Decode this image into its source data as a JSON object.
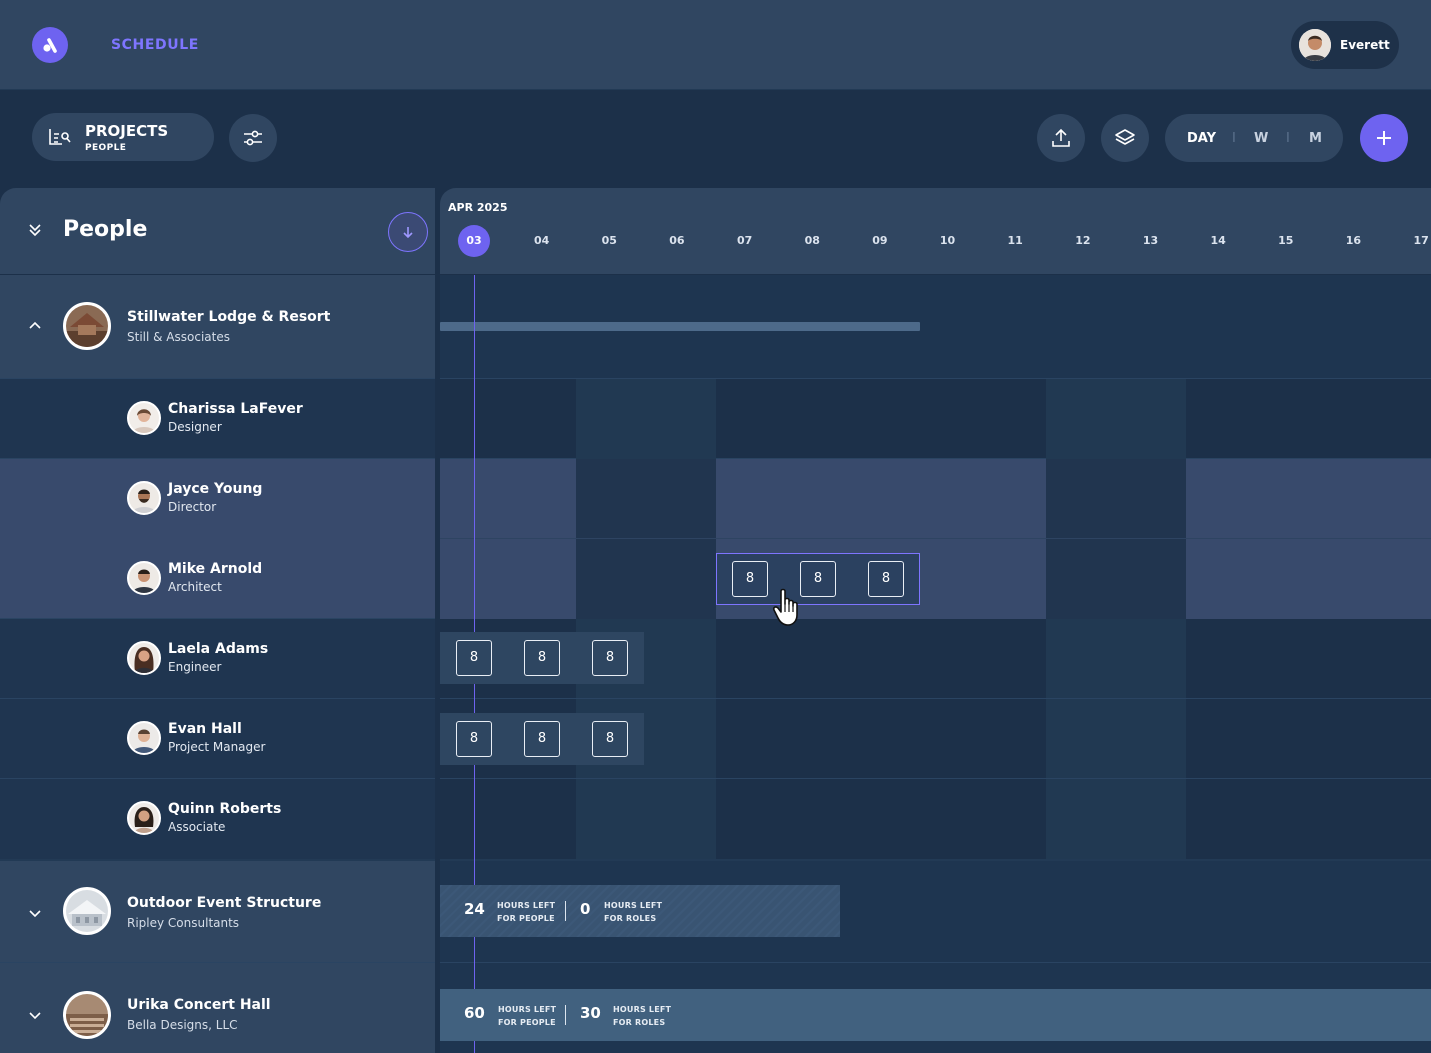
{
  "app": {
    "title": "SCHEDULE",
    "user": "Everett"
  },
  "toolbar": {
    "projects_label": "PROJECTS",
    "people_label": "PEOPLE",
    "view_day": "DAY",
    "view_week": "W",
    "view_month": "M",
    "separator": "I"
  },
  "sidebar": {
    "title": "People"
  },
  "timeline": {
    "month": "APR 2025",
    "days": [
      "03",
      "04",
      "05",
      "06",
      "07",
      "08",
      "09",
      "10",
      "11",
      "12",
      "13",
      "14",
      "15",
      "16",
      "17"
    ],
    "today": "03"
  },
  "projects": [
    {
      "name": "Stillwater Lodge & Resort",
      "client": "Still & Associates",
      "expanded": true,
      "people": [
        {
          "name": "Charissa LaFever",
          "role": "Designer",
          "hours": []
        },
        {
          "name": "Jayce Young",
          "role": "Director",
          "hours": []
        },
        {
          "name": "Mike Arnold",
          "role": "Architect",
          "hours": [
            "8",
            "8",
            "8"
          ]
        },
        {
          "name": "Laela Adams",
          "role": "Engineer",
          "hours": [
            "8",
            "8",
            "8"
          ]
        },
        {
          "name": "Evan Hall",
          "role": "Project Manager",
          "hours": [
            "8",
            "8",
            "8"
          ]
        },
        {
          "name": "Quinn Roberts",
          "role": "Associate",
          "hours": []
        }
      ]
    },
    {
      "name": "Outdoor Event Structure",
      "client": "Ripley Consultants",
      "expanded": false,
      "summary": {
        "people_hours": "24",
        "people_label_1": "HOURS LEFT",
        "people_label_2": "FOR PEOPLE",
        "roles_hours": "0",
        "roles_label_1": "HOURS LEFT",
        "roles_label_2": "FOR ROLES"
      }
    },
    {
      "name": "Urika Concert Hall",
      "client": "Bella Designs, LLC",
      "expanded": false,
      "summary": {
        "people_hours": "60",
        "people_label_1": "HOURS LEFT",
        "people_label_2": "FOR PEOPLE",
        "roles_hours": "30",
        "roles_label_1": "HOURS LEFT",
        "roles_label_2": "FOR ROLES"
      }
    }
  ],
  "colors": {
    "accent": "#6e63f0",
    "background": "#1c3049",
    "panel": "#304661",
    "highlight": "#384a6c"
  }
}
